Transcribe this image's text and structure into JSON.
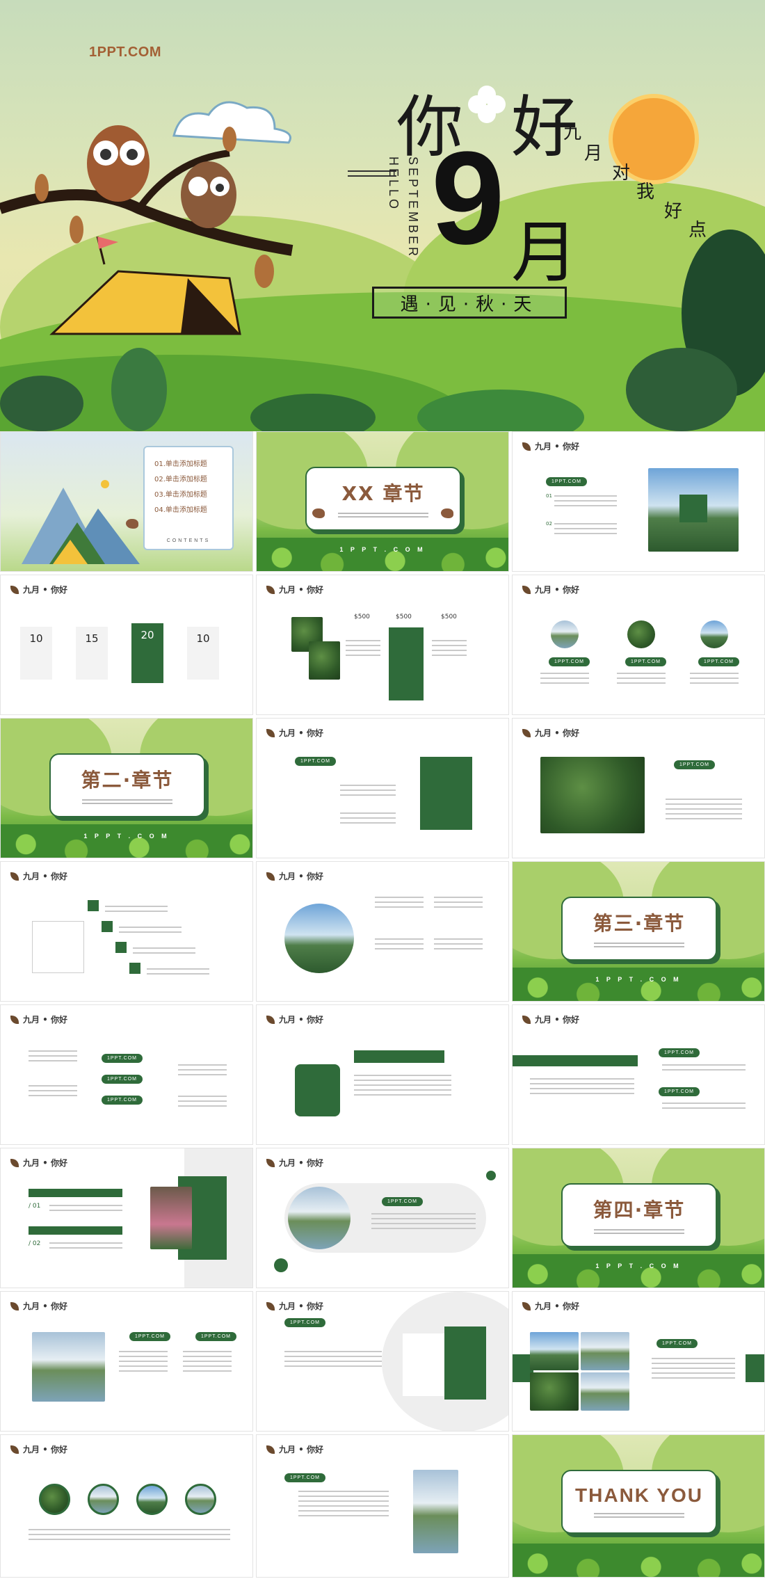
{
  "hero": {
    "brand": "1PPT.COM",
    "title_ni": "你",
    "title_hao": "好",
    "subtitle_chars": [
      "九",
      "月",
      "对",
      "我",
      "好",
      "点"
    ],
    "hello": "HELLO",
    "september": "SEPTEMBER",
    "month_number": "9",
    "month_char": "月",
    "tagline": "遇·见·秋·天",
    "colors": {
      "brand": "#a35f34",
      "sun": "#f5a63a",
      "green_dark": "#2f6b3a",
      "tent": "#f3c23b"
    }
  },
  "common": {
    "header": "九月 • 你好",
    "site": "1PPT.COM",
    "site_spaced": "1 P P T . C O M"
  },
  "contents": {
    "items": [
      "01.单击添加标题",
      "02.单击添加标题",
      "03.单击添加标题",
      "04.单击添加标题"
    ],
    "label": "CONTENTS"
  },
  "chapters": {
    "c1": "XX 章节",
    "c2": "第二·章节",
    "c3": "第三·章节",
    "c4": "第四·章节",
    "thanks": "THANK YOU"
  },
  "slide3": {
    "labels": [
      "01",
      "02"
    ]
  },
  "slide4": {
    "numbers": [
      "10",
      "15",
      "20",
      "10"
    ],
    "active_index": 2
  },
  "slide5": {
    "prices": [
      "$500",
      "$500",
      "$500"
    ]
  },
  "slide17": {
    "labels": [
      "/ 01",
      "/ 02"
    ]
  }
}
